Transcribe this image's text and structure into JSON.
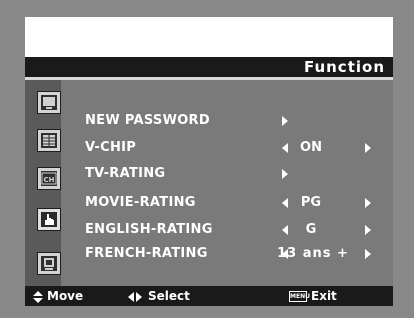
{
  "menu": {
    "title": "Function",
    "icons": [
      "picture-icon",
      "grid-icon",
      "channel-icon",
      "hand-pointer-icon",
      "setup-icon"
    ],
    "rows": [
      {
        "label": "NEW PASSWORD",
        "value": ""
      },
      {
        "label": "V-CHIP",
        "value": "ON"
      },
      {
        "label": "TV-RATING",
        "value": ""
      },
      {
        "label": "MOVIE-RATING",
        "value": "PG"
      },
      {
        "label": "ENGLISH-RATING",
        "value": "G"
      },
      {
        "label": "FRENCH-RATING",
        "value": "13 ans +"
      }
    ]
  },
  "footer": {
    "move": "Move",
    "select": "Select",
    "menu_key": "MENU",
    "exit": "Exit"
  }
}
